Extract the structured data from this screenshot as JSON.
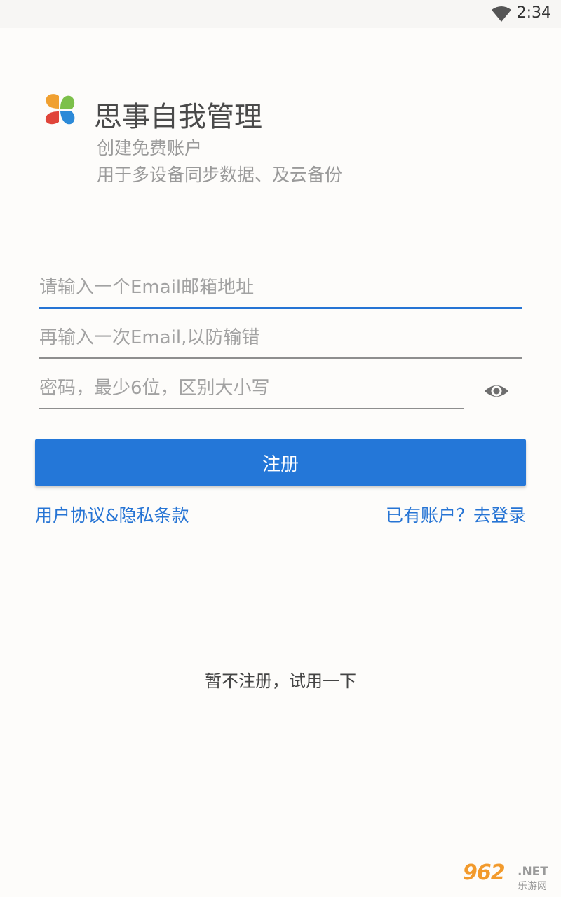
{
  "status_bar": {
    "time": "2:34",
    "wifi_icon": "wifi-icon"
  },
  "app": {
    "title": "思事自我管理",
    "subtitle_1": "创建免费账户",
    "subtitle_2": "用于多设备同步数据、及云备份",
    "logo_icon": "clover-logo-icon"
  },
  "form": {
    "email_placeholder": "请输入一个Email邮箱地址",
    "email_confirm_placeholder": "再输入一次Email,以防输错",
    "password_placeholder": "密码，最少6位，区别大小写",
    "email_value": "",
    "email_confirm_value": "",
    "password_value": "",
    "toggle_icon": "eye-icon",
    "register_label": "注册"
  },
  "links": {
    "terms": "用户协议&隐私条款",
    "login": "已有账户？去登录"
  },
  "try_label": "暂不注册，试用一下",
  "watermark": {
    "brand": "962",
    "domain": ".NET",
    "name": "乐游网"
  },
  "colors": {
    "accent": "#2477d8",
    "link": "#2674d4",
    "background": "#fdfcfa"
  }
}
